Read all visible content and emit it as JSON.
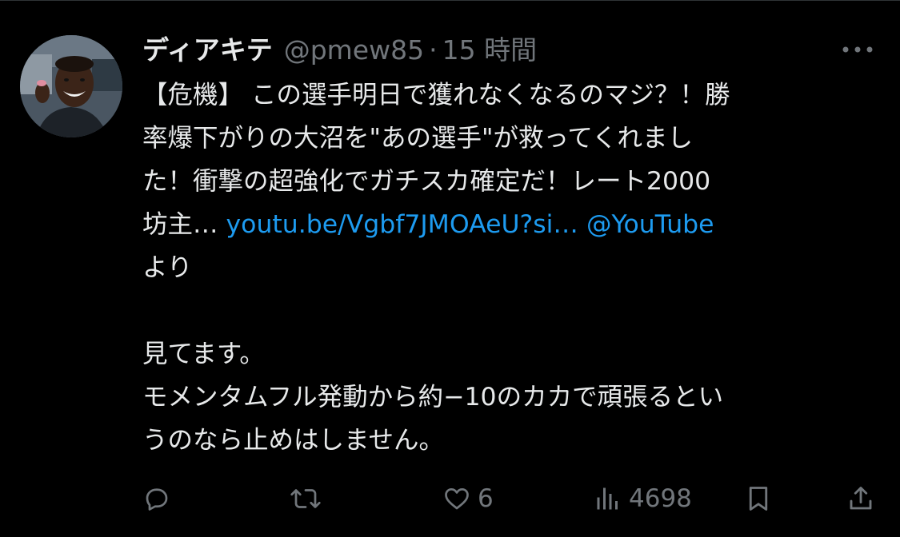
{
  "tweet": {
    "author": {
      "display_name": "ディアキテ",
      "handle": "@pmew85",
      "separator": "·",
      "time": "15 時間"
    },
    "body": {
      "line1": "【危機】 この選手明日で獲れなくなるのマジ？！勝",
      "line2": "率爆下がりの大沼を\"あの選手\"が救ってくれまし",
      "line3": "た！衝撃の超強化でガチスカ確定だ！レート2000",
      "line4_prefix": "坊主…",
      "link_url": "youtu.be/Vgbf7JMOAeU?si…",
      "mention": "@YouTube",
      "line5": "より",
      "line6": "見てます。",
      "line7": "モメンタムフル発動から約−10のカカで頑張るとい",
      "line8": "うのなら止めはしません。"
    },
    "actions": {
      "reply": {
        "icon": "reply-icon",
        "count": ""
      },
      "retweet": {
        "icon": "retweet-icon",
        "count": ""
      },
      "like": {
        "icon": "heart-icon",
        "count": "6"
      },
      "views": {
        "icon": "views-icon",
        "count": "4698"
      },
      "bookmark": {
        "icon": "bookmark-icon"
      },
      "share": {
        "icon": "share-icon"
      }
    }
  },
  "colors": {
    "background": "#000000",
    "text": "#e7e9ea",
    "secondary": "#71767b",
    "link": "#1d9bf0"
  }
}
